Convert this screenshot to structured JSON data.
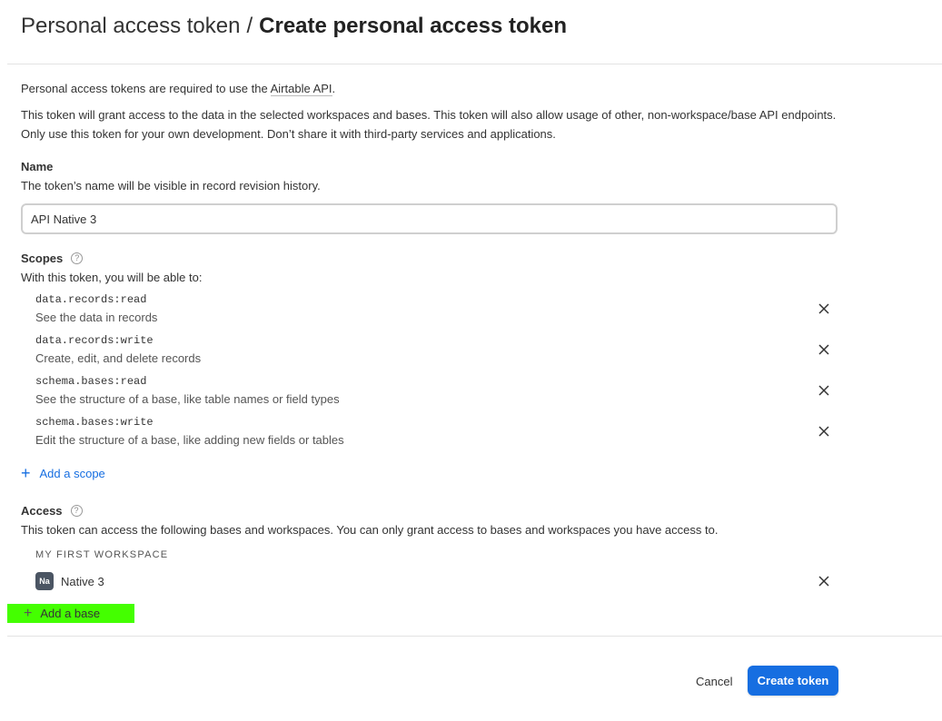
{
  "header": {
    "breadcrumb": "Personal access token",
    "separator": "/",
    "title": "Create personal access token"
  },
  "intro": {
    "line1_prefix": "Personal access tokens are required to use the ",
    "line1_link": "Airtable API",
    "line1_suffix": ".",
    "line2": "This token will grant access to the data in the selected workspaces and bases. This token will also allow usage of other, non-workspace/base API endpoints.",
    "line3": "Only use this token for your own development. Don’t share it with third-party services and applications."
  },
  "name_section": {
    "label": "Name",
    "help": "The token’s name will be visible in record revision history.",
    "value": "API Native 3"
  },
  "scopes_section": {
    "label": "Scopes",
    "help": "With this token, you will be able to:",
    "items": [
      {
        "code": "data.records:read",
        "desc": "See the data in records"
      },
      {
        "code": "data.records:write",
        "desc": "Create, edit, and delete records"
      },
      {
        "code": "schema.bases:read",
        "desc": "See the structure of a base, like table names or field types"
      },
      {
        "code": "schema.bases:write",
        "desc": "Edit the structure of a base, like adding new fields or tables"
      }
    ],
    "add_label": "Add a scope"
  },
  "access_section": {
    "label": "Access",
    "help": "This token can access the following bases and workspaces. You can only grant access to bases and workspaces you have access to.",
    "workspace_name": "MY FIRST WORKSPACE",
    "bases": [
      {
        "badge": "Na",
        "name": "Native 3",
        "badge_color": "#4b5563"
      }
    ],
    "add_label": "Add a base",
    "add_highlight_color": "#44ff00"
  },
  "footer": {
    "cancel_label": "Cancel",
    "create_label": "Create token",
    "accent_color": "#166ee1"
  },
  "icons": {
    "help": "question-circle-icon",
    "remove": "close-icon",
    "add": "plus-icon"
  }
}
